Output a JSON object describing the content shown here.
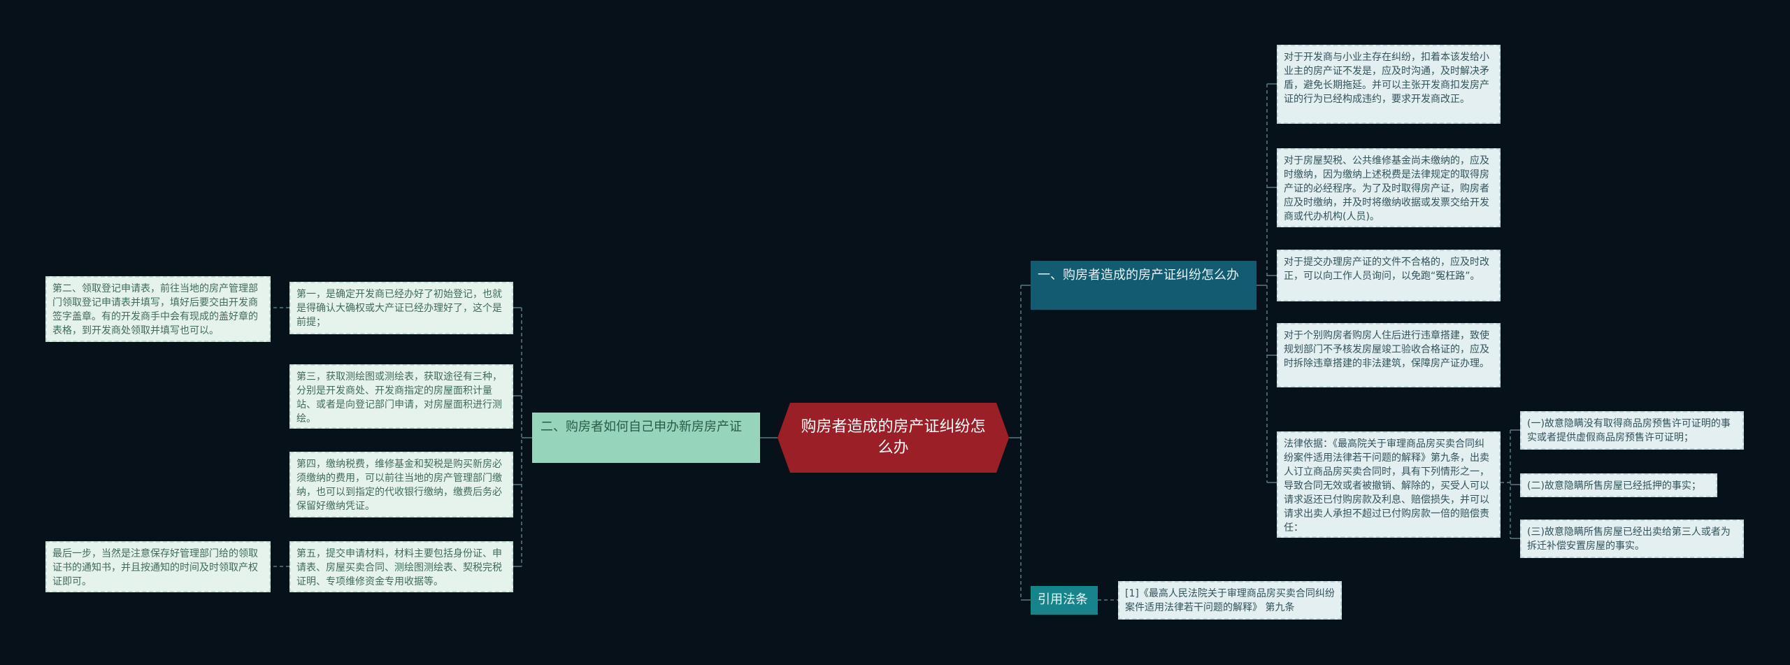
{
  "root": {
    "title": "购房者造成的房产证纠纷怎么办"
  },
  "right_branch": {
    "title": "一、购房者造成的房产证纠纷怎么办",
    "items": [
      "对于开发商与小业主存在纠纷，扣着本该发给小业主的房产证不发是，应及时沟通，及时解决矛盾，避免长期拖延。并可以主张开发商扣发房产证的行为已经构成违约，要求开发商改正。",
      "对于房屋契税、公共维修基金尚未缴纳的，应及时缴纳，因为缴纳上述税费是法律规定的取得房产证的必经程序。为了及时取得房产证，购房者应及时缴纳，并及时将缴纳收据或发票交给开发商或代办机构(人员)。",
      "对于提交办理房产证的文件不合格的，应及时改正，可以向工作人员询问，以免跑“冤枉路”。",
      "对于个别购房者购房人住后进行违章搭建，致使规划部门不予核发房屋竣工验收合格证的，应及时拆除违章搭建的非法建筑，保障房产证办理。",
      "法律依据：《最高院关于审理商品房买卖合同纠纷案件适用法律若干问题的解释》第九条，出卖人订立商品房买卖合同时，具有下列情形之一，导致合同无效或者被撤销、解除的，买受人可以请求返还已付购房款及利息、赔偿损失，并可以请求出卖人承担不超过已付购房款一倍的赔偿责任："
    ],
    "legal_items": [
      "(一)故意隐瞒没有取得商品房预售许可证明的事实或者提供虚假商品房预售许可证明；",
      "(二)故意隐瞒所售房屋已经抵押的事实；",
      "(三)故意隐瞒所售房屋已经出卖给第三人或者为拆迁补偿安置房屋的事实。"
    ]
  },
  "citation_branch": {
    "title": "引用法条",
    "items": [
      "[1]《最高人民法院关于审理商品房买卖合同纠纷案件适用法律若干问题的解释》 第九条"
    ]
  },
  "left_branch": {
    "title": "二、购房者如何自己申办新房房产证",
    "items": [
      "第一，是确定开发商已经办好了初始登记，也就是得确认大确权或大产证已经办理好了，这个是前提；",
      "第三，获取测绘图或测绘表，获取途径有三种，分别是开发商处、开发商指定的房屋面积计量站、或者是向登记部门申请，对房屋面积进行测绘。",
      "第四，缴纳税费，维修基金和契税是购买新房必须缴纳的费用，可以前往当地的房产管理部门缴纳，也可以到指定的代收银行缴纳，缴费后务必保留好缴纳凭证。",
      "第五，提交申请材料，材料主要包括身份证、申请表、房屋买卖合同、测绘图测绘表、契税完税证明、专项维修资金专用收据等。"
    ],
    "sub_items": [
      "第二、领取登记申请表，前往当地的房产管理部门领取登记申请表并填写，填好后要交由开发商签字盖章。有的开发商手中会有现成的盖好章的表格，到开发商处领取并填写也可以。",
      "最后一步，当然是注意保存好管理部门给的领取证书的通知书，并且按通知的时间及时领取产权证即可。"
    ]
  },
  "colors": {
    "background": "#06111a",
    "root": "#9b1f27",
    "branch_right": "#135b70",
    "branch_left": "#97d4bc",
    "branch_cite": "#17848c",
    "connector": "#5c7a80"
  }
}
